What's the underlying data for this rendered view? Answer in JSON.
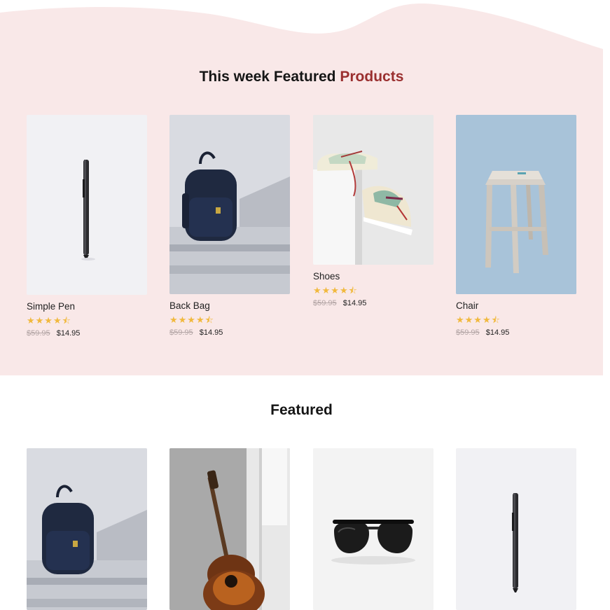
{
  "featured_week": {
    "title_main": "This week Featured",
    "title_accent": "Products",
    "products": [
      {
        "name": "Simple Pen",
        "image": "pen",
        "rating": 4.5,
        "stars": "★★★★⯪",
        "old_price": "$59.95",
        "price": "$14.95"
      },
      {
        "name": "Back Bag",
        "image": "backpack",
        "rating": 4.5,
        "stars": "★★★★⯪",
        "old_price": "$59.95",
        "price": "$14.95"
      },
      {
        "name": "Shoes",
        "image": "shoes",
        "rating": 4.5,
        "stars": "★★★★⯪",
        "old_price": "$59.95",
        "price": "$14.95"
      },
      {
        "name": "Chair",
        "image": "stool",
        "rating": 4.5,
        "stars": "★★★★⯪",
        "old_price": "$59.95",
        "price": "$14.95"
      }
    ]
  },
  "featured": {
    "title": "Featured",
    "products": [
      {
        "image": "backpack"
      },
      {
        "image": "guitar"
      },
      {
        "image": "sunglasses"
      },
      {
        "image": "pen"
      }
    ]
  },
  "colors": {
    "section_bg": "#f9e8e8",
    "accent": "#9a2f2f",
    "star": "#f1b93e"
  }
}
